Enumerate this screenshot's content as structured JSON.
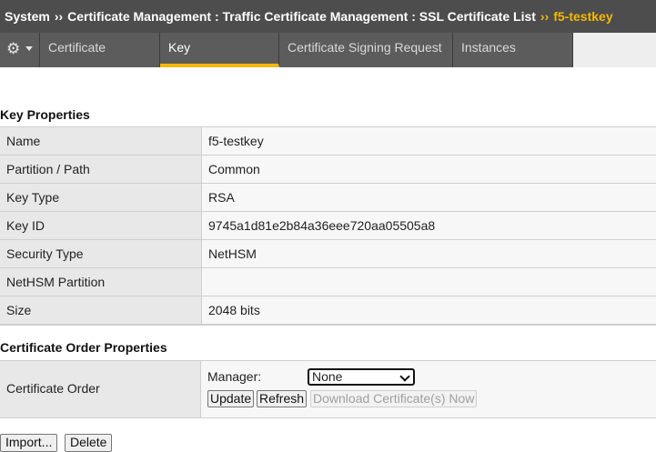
{
  "breadcrumb": {
    "items": [
      "System",
      "Certificate Management : Traffic Certificate Management : SSL Certificate List"
    ],
    "current": "f5-testkey",
    "separator": "››"
  },
  "tabs": [
    {
      "label": "Certificate",
      "active": false
    },
    {
      "label": "Key",
      "active": true
    },
    {
      "label": "Certificate Signing Request",
      "active": false
    },
    {
      "label": "Instances",
      "active": false
    }
  ],
  "key_properties": {
    "title": "Key Properties",
    "rows": [
      {
        "label": "Name",
        "value": "f5-testkey"
      },
      {
        "label": "Partition / Path",
        "value": "Common"
      },
      {
        "label": "Key Type",
        "value": "RSA"
      },
      {
        "label": "Key ID",
        "value": "9745a1d81e2b84a36eee720aa05505a8"
      },
      {
        "label": "Security Type",
        "value": "NetHSM"
      },
      {
        "label": "NetHSM Partition",
        "value": ""
      },
      {
        "label": "Size",
        "value": "2048 bits"
      }
    ]
  },
  "order_properties": {
    "title": "Certificate Order Properties",
    "label": "Certificate Order",
    "manager_label": "Manager:",
    "manager_value": "None",
    "update_label": "Update",
    "refresh_label": "Refresh",
    "download_label": "Download Certificate(s) Now"
  },
  "actions": {
    "import_label": "Import...",
    "delete_label": "Delete"
  },
  "colors": {
    "header_bg": "#4d4d4d",
    "tab_bg": "#5c5c5c",
    "accent": "#f5b800"
  }
}
